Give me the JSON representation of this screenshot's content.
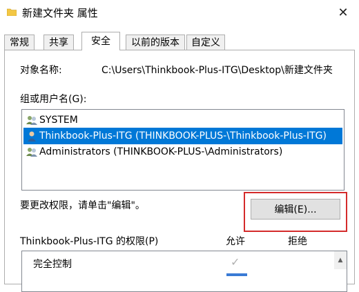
{
  "window": {
    "title": "新建文件夹 属性",
    "close_label": "✕"
  },
  "tabs": [
    {
      "label": "常规"
    },
    {
      "label": "共享"
    },
    {
      "label": "安全"
    },
    {
      "label": "以前的版本"
    },
    {
      "label": "自定义"
    }
  ],
  "security": {
    "object_label": "对象名称:",
    "object_path": "C:\\Users\\Thinkbook-Plus-ITG\\Desktop\\新建文件夹",
    "group_label": "组或用户名(G):",
    "users": [
      {
        "name": "SYSTEM",
        "icon": "users-group-icon"
      },
      {
        "name": "Thinkbook-Plus-ITG (THINKBOOK-PLUS-\\Thinkbook-Plus-ITG)",
        "icon": "user-icon"
      },
      {
        "name": "Administrators (THINKBOOK-PLUS-\\Administrators)",
        "icon": "users-group-icon"
      }
    ],
    "selected_user_index": 1,
    "change_hint": "要更改权限，请单击\"编辑\"。",
    "edit_button": "编辑(E)...",
    "permissions_for": "Thinkbook-Plus-ITG 的权限(P)",
    "allow_header": "允许",
    "deny_header": "拒绝",
    "permissions": [
      {
        "name": "完全控制",
        "allow": true,
        "deny": false
      }
    ]
  },
  "colors": {
    "selection": "#0078d7",
    "highlight_box": "#d42a2a"
  }
}
